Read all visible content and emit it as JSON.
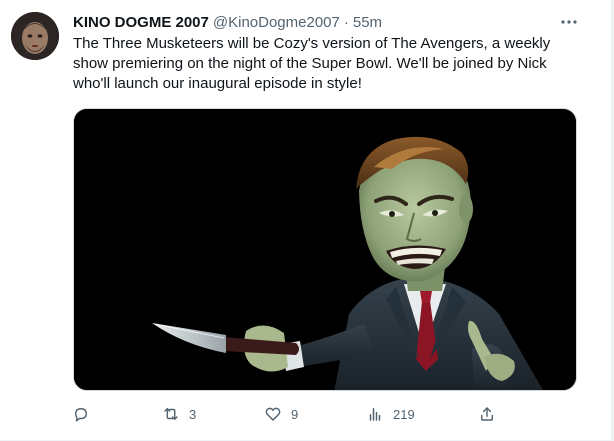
{
  "tweet": {
    "display_name": "KINO DOGME 2007",
    "handle": "@KinoDogme2007",
    "separator": "·",
    "time": "55m",
    "text": "The Three Musketeers will be Cozy's version of The Avengers, a weekly show premiering on the night of the Super Bowl. We'll be joined by Nick who'll launch our inaugural episode in style!",
    "media_alt": "",
    "actions": {
      "reply_count": "",
      "retweet_count": "3",
      "like_count": "9",
      "views_count": "219"
    }
  },
  "icons": {
    "more": "more-horizontal-icon",
    "reply": "reply-icon",
    "retweet": "retweet-icon",
    "like": "heart-icon",
    "views": "views-bar-chart-icon",
    "share": "share-icon"
  },
  "colors": {
    "text": "#0f1419",
    "secondary": "#536471",
    "media_background": "#000000",
    "border": "#cfd9de"
  }
}
